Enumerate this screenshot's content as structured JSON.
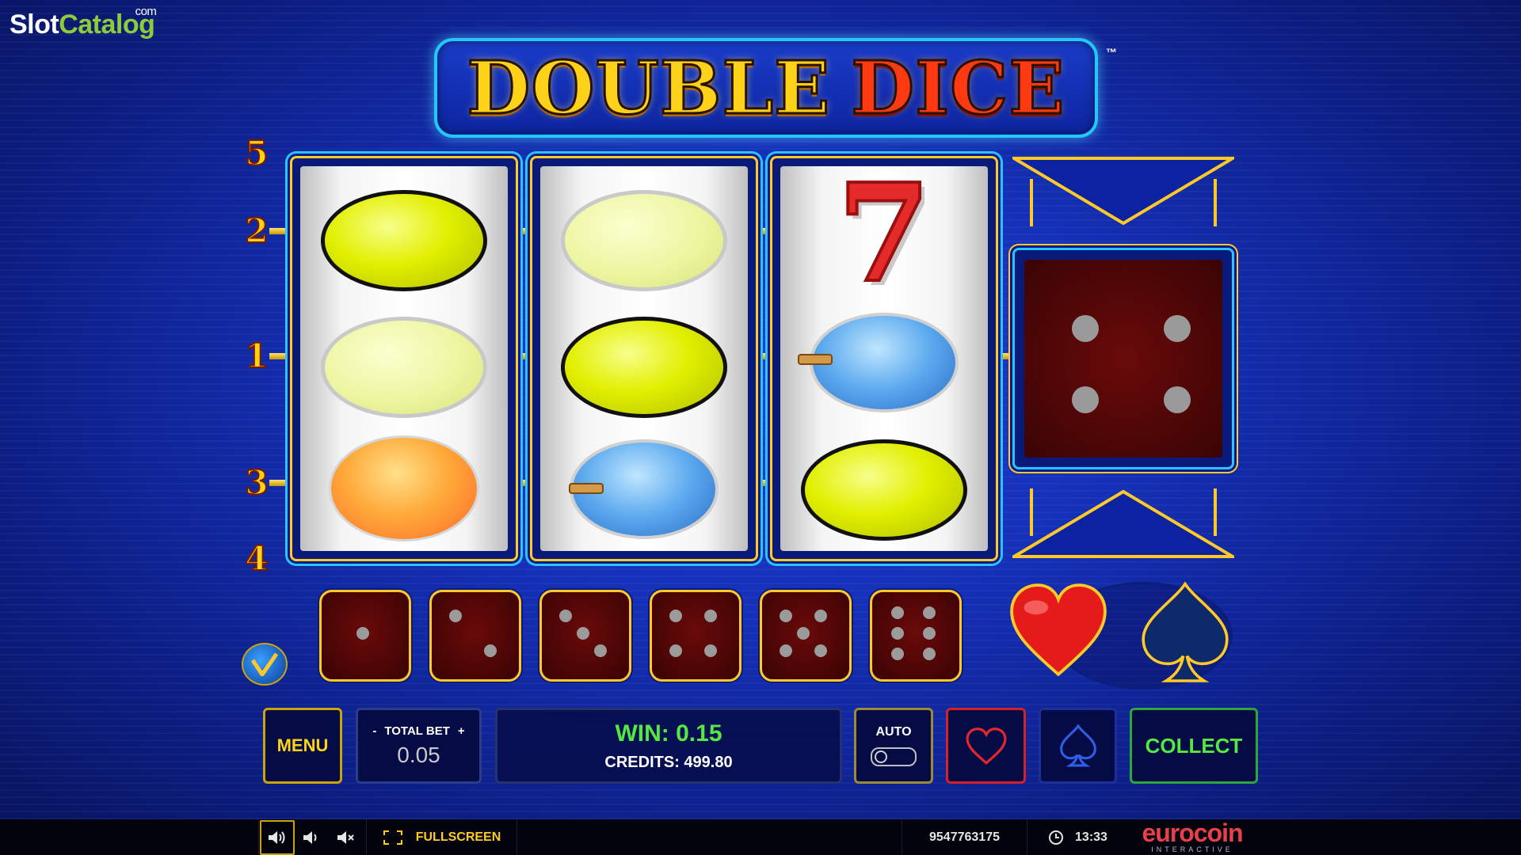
{
  "watermark": {
    "part1": "Slot",
    "part2": "Catalog",
    "suffix": "com"
  },
  "logo": {
    "word1": "DOUBLE",
    "word2": "DICE",
    "tm": "™"
  },
  "paylines": [
    "5",
    "2",
    "1",
    "3",
    "4"
  ],
  "reels": [
    [
      "lemon",
      "lemon-faded",
      "orange"
    ],
    [
      "lemon-faded",
      "lemon",
      "plum"
    ],
    [
      "seven",
      "plum",
      "lemon"
    ]
  ],
  "gamble_die": {
    "value": 4
  },
  "dice_row": [
    1,
    2,
    3,
    4,
    5,
    6
  ],
  "suits": {
    "left": "heart-icon",
    "right": "spade-icon"
  },
  "controls": {
    "menu_label": "MENU",
    "bet_minus": "-",
    "bet_label": "TOTAL BET",
    "bet_plus": "+",
    "bet_value": "0.05",
    "win_text": "WIN: 0.15",
    "credits_text": "CREDITS: 499.80",
    "auto_label": "AUTO",
    "collect_label": "COLLECT"
  },
  "status_bar": {
    "fullscreen_label": "FULLSCREEN",
    "session_id": "9547763175",
    "clock": "13:33",
    "brand_main": "eurocoin",
    "brand_sub": "INTERACTIVE"
  },
  "colors": {
    "accent_gold": "#ffc928",
    "win_green": "#54e840",
    "heart_red": "#d4202a",
    "frame_cyan": "#2bc4ff"
  }
}
